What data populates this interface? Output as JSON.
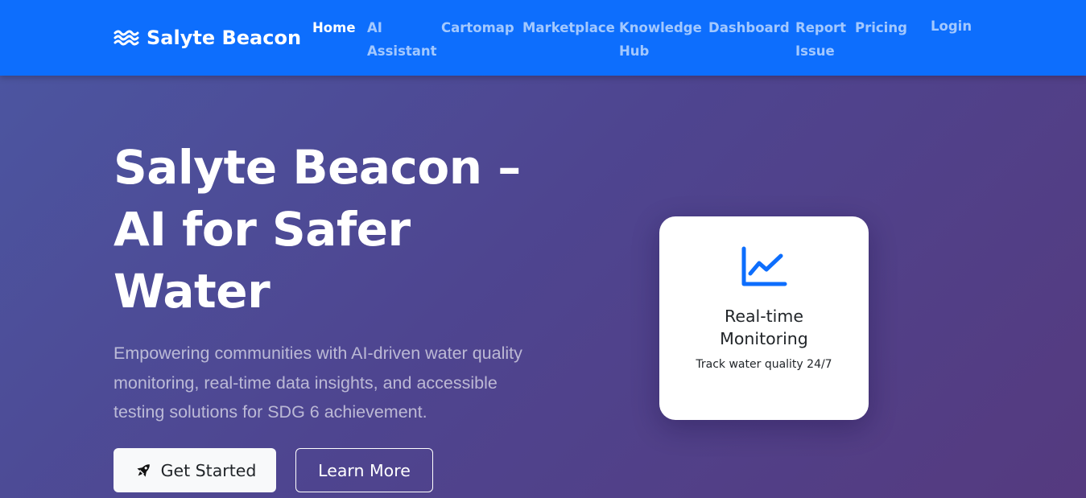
{
  "brand": {
    "name": "Salyte Beacon",
    "icon": "water-waves-icon"
  },
  "nav": {
    "items": [
      {
        "lines": [
          "Home"
        ],
        "active": true
      },
      {
        "lines": [
          "AI",
          "Assistant"
        ],
        "active": false
      },
      {
        "lines": [
          "Cartomap"
        ],
        "active": false
      },
      {
        "lines": [
          "Marketplace"
        ],
        "active": false
      },
      {
        "lines": [
          "Knowledge",
          "Hub"
        ],
        "active": false
      },
      {
        "lines": [
          "Dashboard"
        ],
        "active": false
      },
      {
        "lines": [
          "Report",
          "Issue"
        ],
        "active": false
      },
      {
        "lines": [
          "Pricing"
        ],
        "active": false
      }
    ],
    "login": "Login"
  },
  "hero": {
    "title_lines": [
      "Salyte Beacon –",
      "AI for Safer",
      "Water"
    ],
    "subtitle": "Empowering communities with AI-driven water quality monitoring, real-time data insights, and accessible testing solutions for SDG 6 achievement.",
    "primary_button": {
      "label": "Get Started",
      "icon": "rocket-icon"
    },
    "secondary_button": {
      "label": "Learn More"
    }
  },
  "feature_card": {
    "icon": "line-chart-icon",
    "title_lines": [
      "Real-time",
      "Monitoring"
    ],
    "text": "Track water quality 24/7"
  },
  "colors": {
    "navbar": "#0d6efd",
    "hero_gradient_start": "#4c55a0",
    "hero_gradient_end": "#553a7f",
    "accent": "#0d6efd"
  }
}
